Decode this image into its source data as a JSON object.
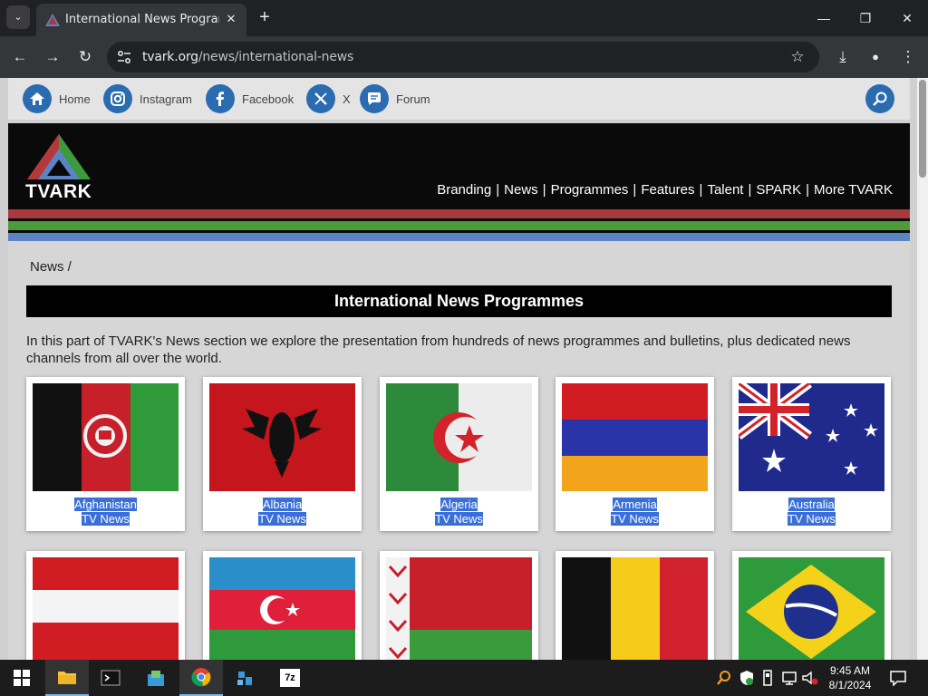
{
  "browser": {
    "tab_menu_glyph": "⌄",
    "tab_title": "International News Programmes",
    "tab_close_glyph": "✕",
    "new_tab_glyph": "+",
    "url_host": "tvark.org",
    "url_path": "/news/international-news",
    "window_controls": {
      "minimize": "—",
      "maximize": "❐",
      "close": "✕"
    },
    "nav_glyphs": {
      "back": "←",
      "forward": "→",
      "reload": "↻",
      "bookmark": "☆",
      "download": "⤓",
      "profile": "●",
      "menu": "⋮"
    }
  },
  "social": {
    "items": [
      {
        "label": "Home",
        "icon": "home-icon"
      },
      {
        "label": "Instagram",
        "icon": "instagram-icon"
      },
      {
        "label": "Facebook",
        "icon": "facebook-icon"
      },
      {
        "label": "X",
        "icon": "x-icon"
      },
      {
        "label": "Forum",
        "icon": "forum-icon"
      }
    ],
    "search_icon": "search-icon"
  },
  "header": {
    "logo_text": "TVARK",
    "menu": [
      "Branding",
      "News",
      "Programmes",
      "Features",
      "Talent",
      "SPARK",
      "More TVARK"
    ],
    "menu_separator": "|",
    "stripe_colors": [
      "#a73a3c",
      "#4e9a3a",
      "#5b84c4"
    ]
  },
  "content": {
    "breadcrumb": "News /",
    "title": "International News Programmes",
    "intro": "In this part of TVARK's News section we explore the presentation from hundreds of news programmes and bulletins, plus dedicated news channels from all over the world.",
    "cards": [
      {
        "country": "Afghanistan",
        "subtitle": "TV News"
      },
      {
        "country": "Albania",
        "subtitle": "TV News"
      },
      {
        "country": "Algeria",
        "subtitle": "TV News"
      },
      {
        "country": "Armenia",
        "subtitle": "TV News"
      },
      {
        "country": "Australia",
        "subtitle": "TV News"
      }
    ],
    "cards_row2_flags": [
      "austria-flag",
      "azerbaijan-flag",
      "belarus-flag",
      "belgium-flag",
      "brazil-flag"
    ]
  },
  "taskbar": {
    "apps": [
      "start-button",
      "file-explorer",
      "terminal",
      "app-installer",
      "chrome",
      "network-app",
      "7zip"
    ],
    "seven_zip_label": "7z",
    "clock_time": "9:45 AM",
    "clock_date": "8/1/2024"
  }
}
